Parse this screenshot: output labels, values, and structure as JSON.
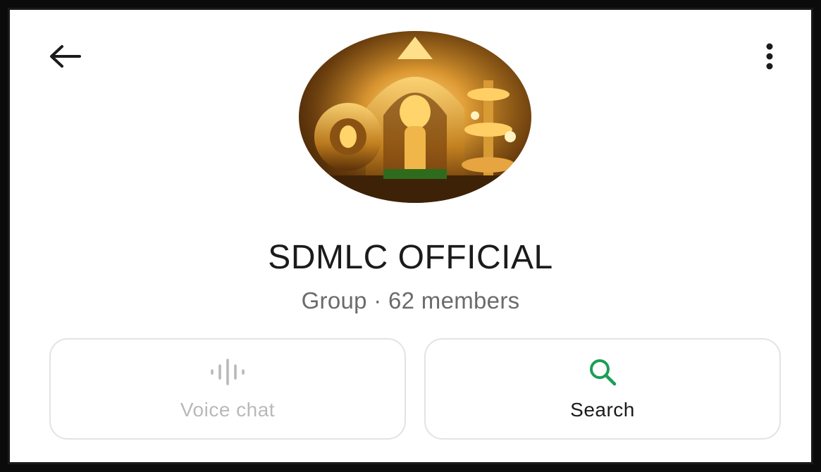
{
  "header": {
    "back_icon": "arrow-left-icon",
    "menu_icon": "more-vertical-icon"
  },
  "group": {
    "name": "SDMLC OFFICIAL",
    "subtitle": "Group · 62 members",
    "avatar": "group-avatar-image"
  },
  "actions": {
    "voice_chat": {
      "label": "Voice chat",
      "icon": "waveform-icon",
      "enabled": false
    },
    "search": {
      "label": "Search",
      "icon": "search-icon",
      "enabled": true
    }
  },
  "colors": {
    "accent": "#1a9e57",
    "disabled": "#b9b9b9",
    "text": "#1b1b1b",
    "muted": "#6b6b6b"
  }
}
